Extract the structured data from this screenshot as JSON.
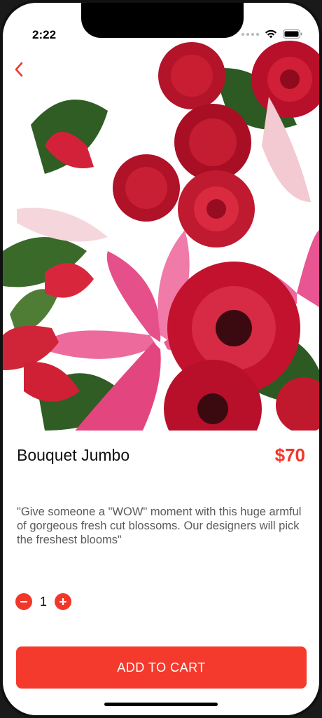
{
  "status_bar": {
    "time": "2:22"
  },
  "product": {
    "title": "Bouquet Jumbo",
    "price": "$70",
    "description": "\"Give someone a \"WOW\" moment with this huge armful of gorgeous fresh cut blossoms. Our designers will pick the freshest blooms\"",
    "image_icon": "flower-bouquet-image"
  },
  "quantity": {
    "value": "1",
    "decrement_icon": "minus-icon",
    "increment_icon": "plus-icon"
  },
  "actions": {
    "add_to_cart_label": "ADD TO CART"
  },
  "navigation": {
    "back_icon": "chevron-left-icon"
  },
  "colors": {
    "accent": "#f2372a",
    "button": "#f43a2c"
  }
}
